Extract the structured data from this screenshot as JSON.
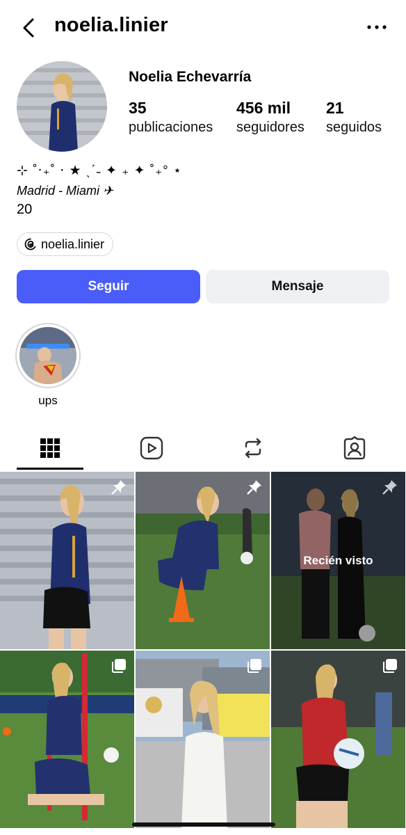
{
  "header": {
    "username": "noelia.linier",
    "back_icon": "chevron-left-icon",
    "more_icon": "more-horizontal-icon"
  },
  "profile": {
    "full_name": "Noelia Echevarría",
    "stats": [
      {
        "value": "35",
        "label": "publicaciones"
      },
      {
        "value": "456 mil",
        "label": "seguidores"
      },
      {
        "value": "21",
        "label": "seguidos"
      }
    ],
    "bio": {
      "line1": "⊹ ˚‧₊˚ ⋅ ★ ˎˊ˗ ✦ ₊ ✦ ˚₊° ⋆",
      "line2": "Madrid - Miami ✈",
      "line3": "20"
    },
    "threads_handle": "noelia.linier"
  },
  "actions": {
    "follow_label": "Seguir",
    "message_label": "Mensaje",
    "follow_color": "#4a5df9"
  },
  "highlights": [
    {
      "label": "ups"
    }
  ],
  "tabs": [
    {
      "name": "grid",
      "icon": "grid-icon",
      "active": true
    },
    {
      "name": "reels",
      "icon": "reels-icon",
      "active": false
    },
    {
      "name": "reposts",
      "icon": "repost-icon",
      "active": false
    },
    {
      "name": "tagged",
      "icon": "tagged-icon",
      "active": false
    }
  ],
  "grid": {
    "seen_label": "Recién visto",
    "posts": [
      {
        "badge": "pin-icon"
      },
      {
        "badge": "pin-icon"
      },
      {
        "badge": "pin-icon",
        "seen": true
      },
      {
        "badge": "carousel-icon"
      },
      {
        "badge": "carousel-icon"
      },
      {
        "badge": "carousel-icon"
      }
    ]
  }
}
